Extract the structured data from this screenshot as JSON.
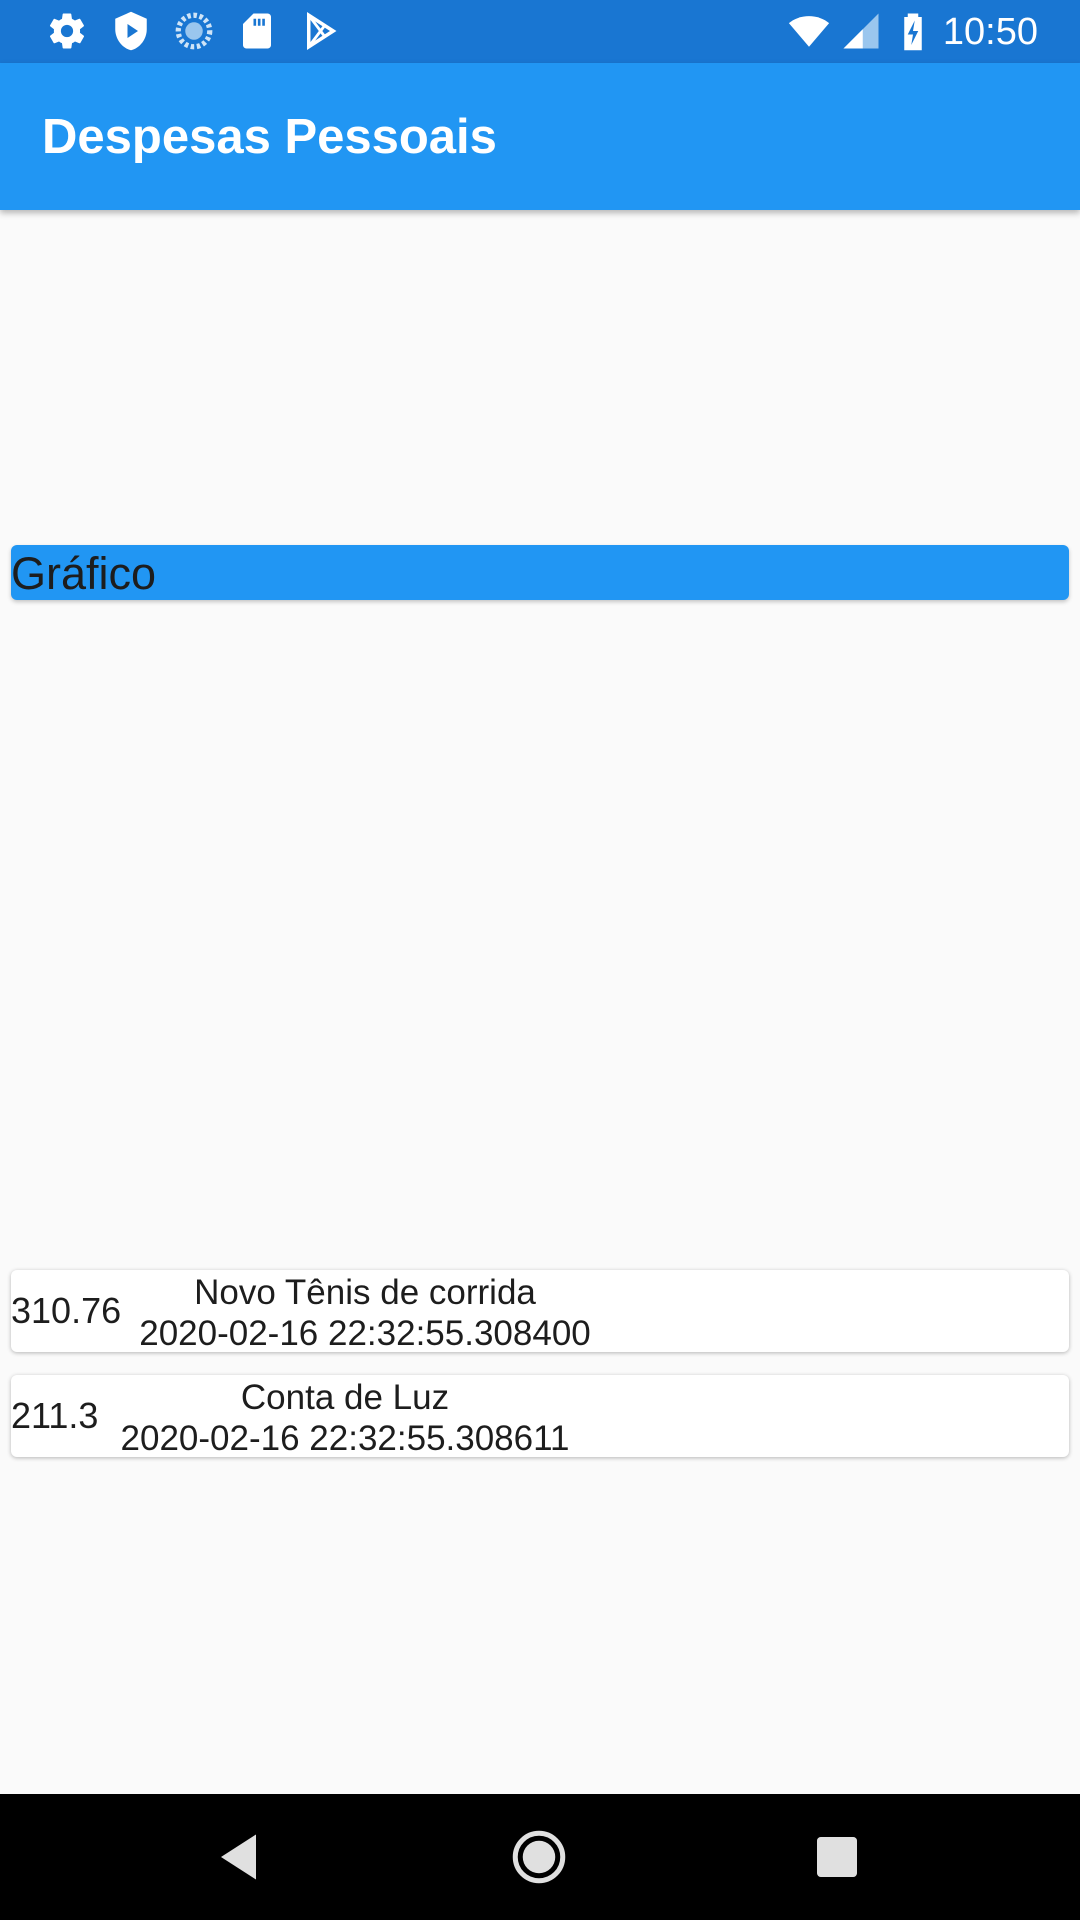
{
  "status_bar": {
    "time": "10:50",
    "left_icons": [
      "settings-icon",
      "shield-icon",
      "loading-icon",
      "sd-card-icon",
      "play-store-icon"
    ],
    "right_icons": [
      "wifi-icon",
      "cell-signal-icon",
      "battery-charging-icon"
    ]
  },
  "app_bar": {
    "title": "Despesas Pessoais",
    "color": "#2196f3"
  },
  "chart": {
    "label": "Gráfico"
  },
  "transactions": [
    {
      "value": "310.76",
      "title": "Novo Tênis de corrida",
      "date": "2020-02-16 22:32:55.308400"
    },
    {
      "value": "211.3",
      "title": "Conta de Luz",
      "date": "2020-02-16 22:32:55.308611"
    }
  ],
  "nav_bar": {
    "buttons": [
      "back-icon",
      "home-icon",
      "recents-icon"
    ]
  },
  "colors": {
    "status_bar": "#1976d2",
    "primary": "#2196f3",
    "background": "#fafafa"
  }
}
